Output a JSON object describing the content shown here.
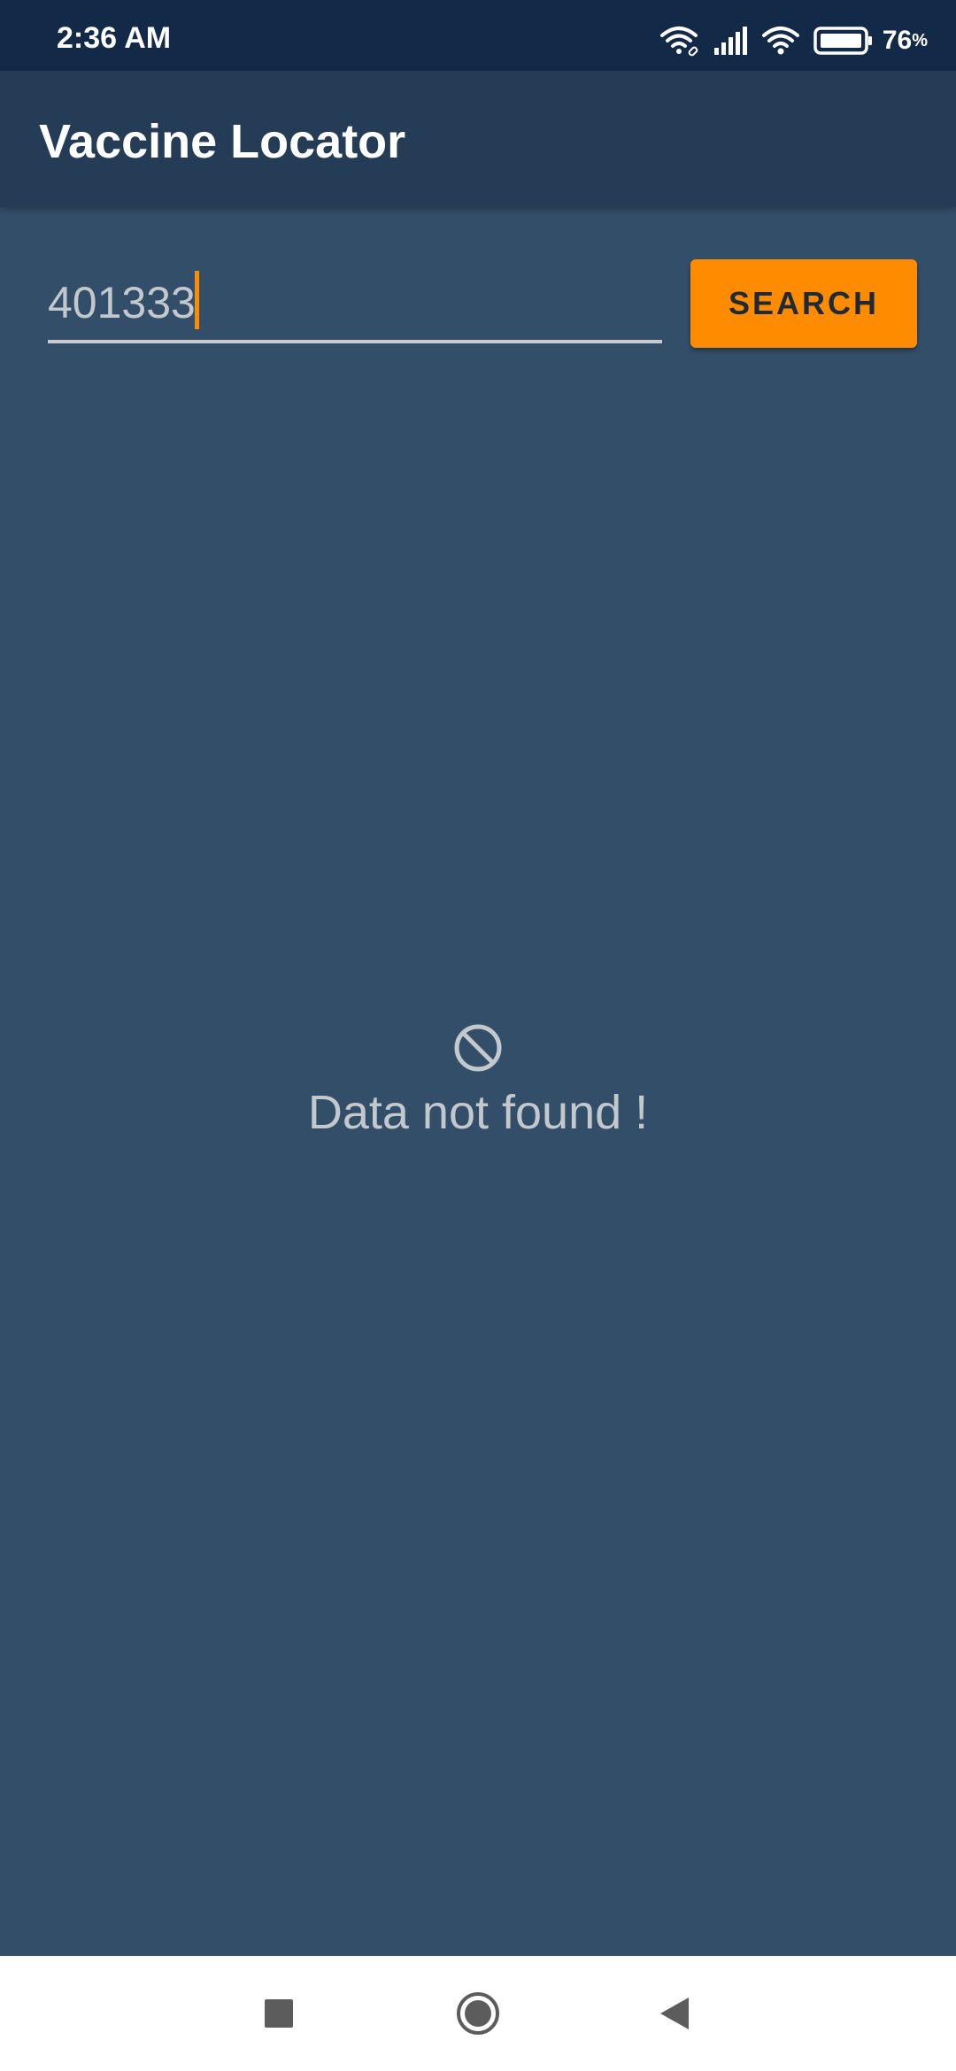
{
  "status_bar": {
    "time": "2:36 AM",
    "battery_level": "76",
    "battery_unit": "%",
    "icons": [
      "wifi-link-icon",
      "signal-icon",
      "wifi-icon",
      "battery-icon"
    ]
  },
  "app_bar": {
    "title": "Vaccine Locator"
  },
  "search": {
    "value": "401333",
    "button_label": "SEARCH"
  },
  "empty_state": {
    "icon": "ban-icon",
    "message": "Data not found !"
  },
  "nav_bar": {
    "icons": [
      "recents-square-icon",
      "home-circle-icon",
      "back-triangle-icon"
    ]
  },
  "colors": {
    "status_bar_bg": "#122a47",
    "app_bar_bg": "#253c57",
    "content_bg": "#334e69",
    "accent": "#ff8c00",
    "muted_text": "#c3c8cd"
  }
}
